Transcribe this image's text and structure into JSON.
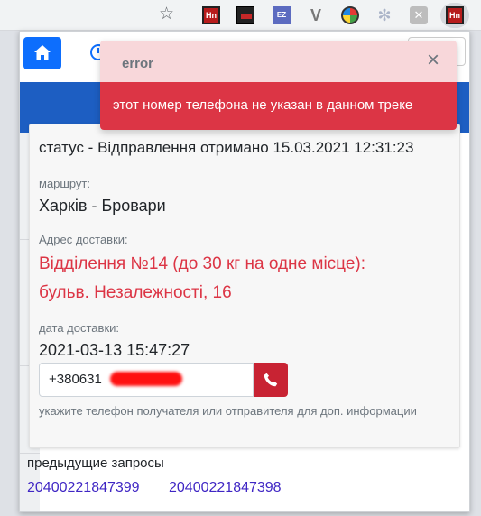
{
  "browser": {
    "extensions": [
      {
        "name": "hn",
        "label": "Hn"
      },
      {
        "name": "short",
        "label": ""
      },
      {
        "name": "ez",
        "label": "EZ"
      },
      {
        "name": "v",
        "label": "V"
      },
      {
        "name": "circle",
        "label": ""
      },
      {
        "name": "gear",
        "label": ""
      },
      {
        "name": "close",
        "label": "✕"
      },
      {
        "name": "hn-active",
        "label": "Hn"
      }
    ]
  },
  "popup": {
    "toast": {
      "title": "error",
      "close_label": "×",
      "message": "этот номер телефона не указан в данном треке"
    },
    "card": {
      "status": "статус - Відправлення отримано 15.03.2021 12:31:23",
      "route_label": "маршрут:",
      "route_value": "Харків - Бровари",
      "address_label": "Адрес доставки:",
      "address_line1": "Відділення №14 (до 30 кг на одне місце):",
      "address_line2": "бульв. Незалежності, 16",
      "delivery_date_label": "дата доставки:",
      "delivery_date_value": "2021-03-13 15:47:27",
      "phone_value": "+380631",
      "hint": "укажите телефон получателя или отправителя для доп. информации"
    },
    "previous": {
      "title": "предыдущие запросы",
      "items": [
        "20400221847399",
        "20400221847398"
      ]
    }
  },
  "colors": {
    "primary": "#0d6efd",
    "danger": "#dc3545",
    "toast_header": "#f8d7da",
    "link": "#3f26c4"
  }
}
